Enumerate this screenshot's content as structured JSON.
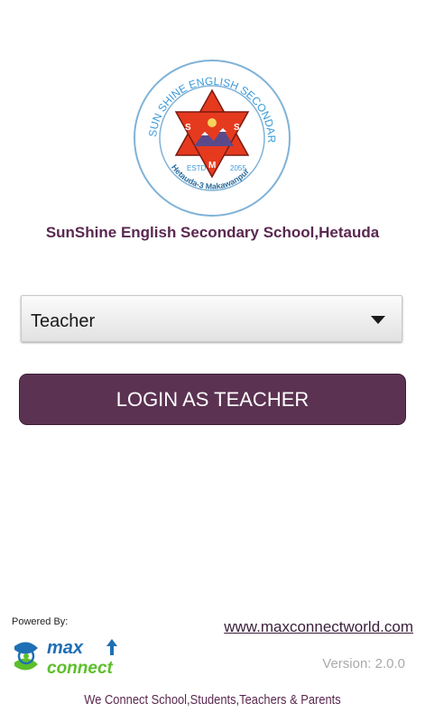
{
  "school": {
    "logo_ring_text": "SUN SHINE ENGLISH SECONDARY SCHOOL",
    "logo_initials": [
      "S",
      "S",
      "E",
      "M",
      "S"
    ],
    "logo_estd": "ESTD",
    "logo_year": "2055",
    "logo_location": "Hetauda-3  Makawanpur",
    "name": "SunShine English Secondary School,Hetauda"
  },
  "role_select": {
    "selected": "Teacher"
  },
  "login_button": {
    "label": "LOGIN AS TEACHER"
  },
  "footer": {
    "powered_by": "Powered By:",
    "brand_top": "max",
    "brand_bottom": "connect",
    "website": "www.maxconnectworld.com",
    "version": "Version: 2.0.0",
    "tagline": "We Connect School,Students,Teachers & Parents"
  },
  "colors": {
    "brand_purple": "#5b3252",
    "logo_star": "#e63a1f",
    "logo_ring": "#3a9ad9",
    "max_green": "#5cbf2a",
    "max_blue": "#1f6fb5"
  }
}
